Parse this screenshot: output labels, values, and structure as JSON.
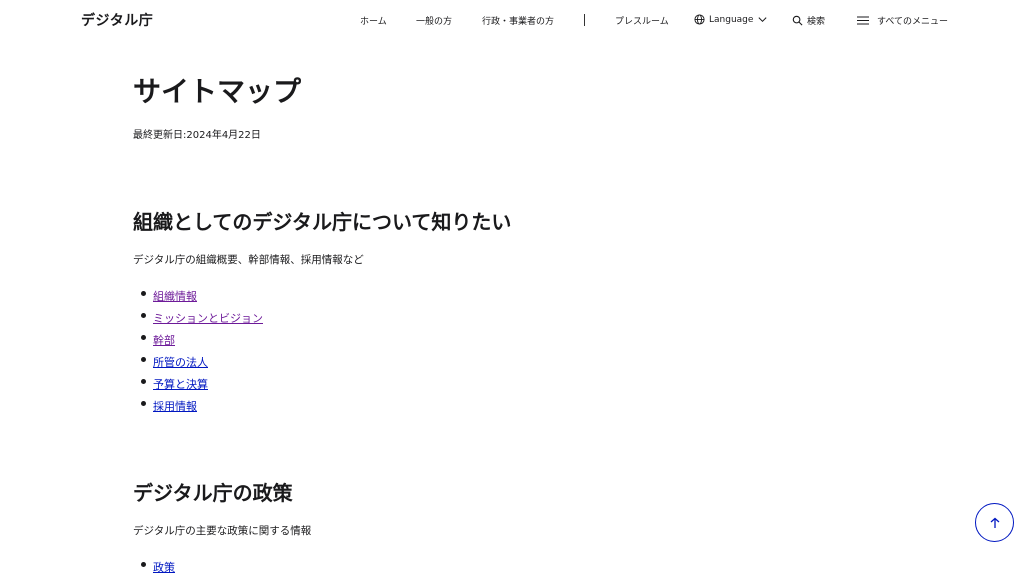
{
  "header": {
    "logo": "デジタル庁",
    "nav": {
      "home": "ホーム",
      "general": "一般の方",
      "business": "行政・事業者の方",
      "press": "プレスルーム",
      "language": "Language",
      "search": "検索",
      "all_menu": "すべてのメニュー"
    }
  },
  "page": {
    "title": "サイトマップ",
    "updated": "最終更新日:2024年4月22日"
  },
  "sections": [
    {
      "title": "組織としてのデジタル庁について知りたい",
      "description": "デジタル庁の組織概要、幹部情報、採用情報など",
      "links": [
        "組織情報",
        "ミッションとビジョン",
        "幹部",
        "所管の法人",
        "予算と決算",
        "採用情報"
      ]
    },
    {
      "title": "デジタル庁の政策",
      "description": "デジタル庁の主要な政策に関する情報",
      "links": [
        "政策"
      ]
    }
  ],
  "colors": {
    "link": "#0017c1",
    "link_visited": "#6d1a99",
    "text": "#1a1a1c"
  },
  "icons": {
    "language": "globe-icon",
    "language_caret": "chevron-down-icon",
    "search": "search-icon",
    "menu": "hamburger-icon",
    "scroll_top": "arrow-up-icon"
  }
}
